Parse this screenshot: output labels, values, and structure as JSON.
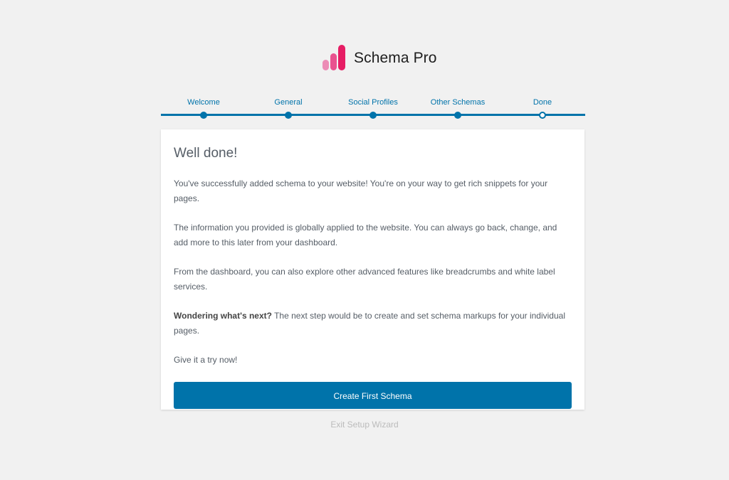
{
  "brand": {
    "name": "Schema Pro",
    "colors": {
      "bar_light": "#ec8cb6",
      "bar_mid": "#e9528f",
      "bar_dark": "#e61d64"
    }
  },
  "steps": [
    {
      "label": "Welcome",
      "state": "completed"
    },
    {
      "label": "General",
      "state": "completed"
    },
    {
      "label": "Social Profiles",
      "state": "completed"
    },
    {
      "label": "Other Schemas",
      "state": "completed"
    },
    {
      "label": "Done",
      "state": "current"
    }
  ],
  "card": {
    "title": "Well done!",
    "p1": "You've successfully added schema to your website! You're on your way to get rich snippets for your pages.",
    "p2": "The information you provided is globally applied to the website. You can always go back, change, and add more to this later from your dashboard.",
    "p3": "From the dashboard, you can also explore other advanced features like breadcrumbs and white label services.",
    "p4_bold": "Wondering what's next?",
    "p4_rest": " The next step would be to create and set schema markups for your individual pages.",
    "p5": "Give it a try now!",
    "button": "Create First Schema"
  },
  "exit_link": "Exit Setup Wizard",
  "colors": {
    "accent": "#0073aa",
    "background": "#f1f1f1"
  }
}
